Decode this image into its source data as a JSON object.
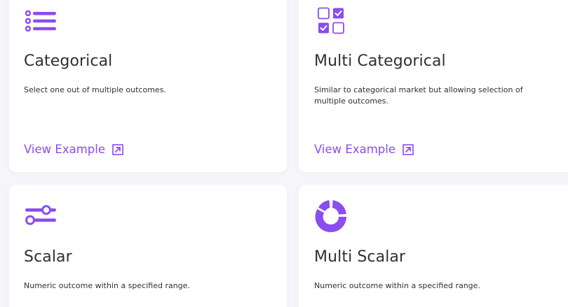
{
  "colors": {
    "accent": "#8b4cf0",
    "text": "#2f2f36",
    "card_bg": "#ffffff",
    "page_bg": "#f6f5f9"
  },
  "cards": [
    {
      "title": "Categorical",
      "description": "Select one out of multiple outcomes.",
      "link_label": "View Example",
      "icon": "list-icon",
      "link_icon": "external-link-icon"
    },
    {
      "title": "Multi Categorical",
      "description": "Similar to categorical market but allowing selection of multiple outcomes.",
      "link_label": "View Example",
      "icon": "checkbox-grid-icon",
      "link_icon": "external-link-icon"
    },
    {
      "title": "Scalar",
      "description": "Numeric outcome within a specified range.",
      "icon": "sliders-icon"
    },
    {
      "title": "Multi Scalar",
      "description": "Numeric outcome within a specified range.",
      "icon": "donut-chart-icon"
    }
  ]
}
